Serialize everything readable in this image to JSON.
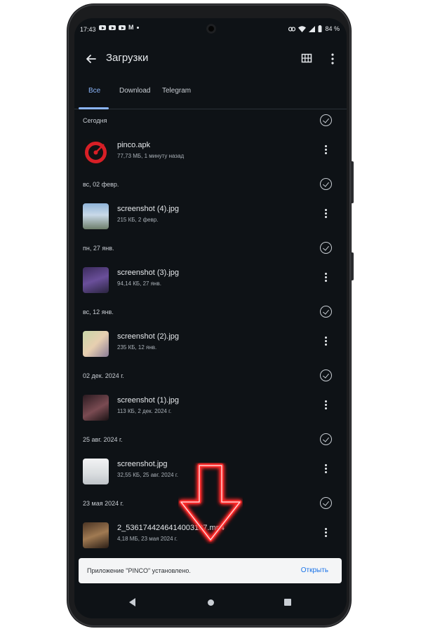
{
  "status_bar": {
    "time": "17:43",
    "battery": "84 %"
  },
  "app_bar": {
    "title": "Загрузки"
  },
  "tabs": [
    {
      "label": "Все",
      "active": true
    },
    {
      "label": "Download",
      "active": false
    },
    {
      "label": "Telegram",
      "active": false
    }
  ],
  "sections": [
    {
      "label": "Сегодня",
      "file": {
        "name": "pinco.apk",
        "meta": "77,73 МБ, 1 минуту назад"
      }
    },
    {
      "label": "вс, 02 февр.",
      "file": {
        "name": "screenshot (4).jpg",
        "meta": "215 КБ, 2 февр."
      }
    },
    {
      "label": "пн, 27 янв.",
      "file": {
        "name": "screenshot (3).jpg",
        "meta": "94,14 КБ, 27 янв."
      }
    },
    {
      "label": "вс, 12 янв.",
      "file": {
        "name": "screenshot (2).jpg",
        "meta": "235 КБ, 12 янв."
      }
    },
    {
      "label": "02 дек. 2024 г.",
      "file": {
        "name": "screenshot (1).jpg",
        "meta": "113 КБ, 2 дек. 2024 г."
      }
    },
    {
      "label": "25 авг. 2024 г.",
      "file": {
        "name": "screenshot.jpg",
        "meta": "32,55 КБ, 25 авг. 2024 г."
      }
    },
    {
      "label": "23 мая 2024 г.",
      "file": {
        "name": "2_5361744246414003107.mp4",
        "meta": "4,18 МБ, 23 мая 2024 г."
      }
    }
  ],
  "snackbar": {
    "message": "Приложение \"PINCO\" установлено.",
    "action": "Открыть"
  },
  "colors": {
    "background": "#0e1216",
    "accent": "#8ab4f8",
    "action": "#1a73e8",
    "arrow": "#ff2a2a"
  },
  "icons": [
    "back-arrow-icon",
    "grid-view-icon",
    "more-vert-icon",
    "check-circle-icon",
    "wifi-icon",
    "battery-icon"
  ]
}
